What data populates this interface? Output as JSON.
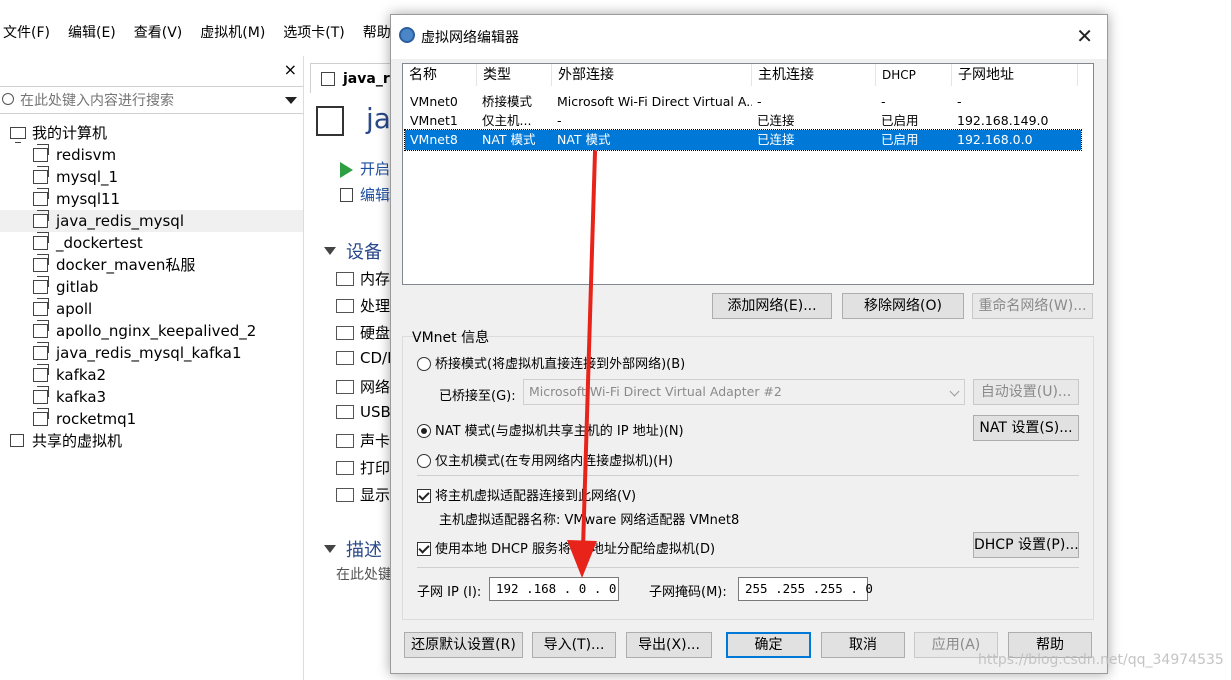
{
  "app": {
    "menu": [
      "文件(F)",
      "编辑(E)",
      "查看(V)",
      "虚拟机(M)",
      "选项卡(T)",
      "帮助"
    ],
    "library": {
      "close": "×",
      "search_placeholder": "在此处键入内容进行搜索",
      "root": "我的计算机",
      "vms": [
        "redisvm",
        "mysql_1",
        "mysql11",
        "java_redis_mysql",
        "_dockertest",
        "docker_maven私服",
        "gitlab",
        "apoll",
        "apollo_nginx_keepalived_2",
        "java_redis_mysql_kafka1",
        "kafka2",
        "kafka3",
        "rocketmq1"
      ],
      "shared": "共享的虚拟机"
    },
    "tab_label": "java_re",
    "vm_title": "jav",
    "actions": [
      "开启",
      "编辑"
    ],
    "devices_header": "设备",
    "devices": [
      "内存",
      "处理",
      "硬盘",
      "CD/D",
      "网络",
      "USB",
      "声卡",
      "打印",
      "显示"
    ],
    "describe_header": "描述",
    "describe_text": "在此处键"
  },
  "dialog": {
    "title": "虚拟网络编辑器",
    "close": "✕",
    "columns": [
      "名称",
      "类型",
      "外部连接",
      "主机连接",
      "DHCP",
      "子网地址"
    ],
    "rows": [
      [
        "VMnet0",
        "桥接模式",
        "Microsoft Wi-Fi Direct Virtual A...",
        "-",
        "-",
        "-"
      ],
      [
        "VMnet1",
        "仅主机...",
        "-",
        "已连接",
        "已启用",
        "192.168.149.0"
      ],
      [
        "VMnet8",
        "NAT 模式",
        "NAT 模式",
        "已连接",
        "已启用",
        "192.168.0.0"
      ]
    ],
    "selected_row": 2,
    "buttons": {
      "add": "添加网络(E)...",
      "remove": "移除网络(O)",
      "rename": "重命名网络(W)...",
      "auto": "自动设置(U)...",
      "nat": "NAT 设置(S)...",
      "dhcp": "DHCP 设置(P)...",
      "restore": "还原默认设置(R)",
      "import": "导入(T)...",
      "export": "导出(X)...",
      "ok": "确定",
      "cancel": "取消",
      "apply": "应用(A)",
      "help": "帮助"
    },
    "info_label": "VMnet 信息",
    "radio_bridge": "桥接模式(将虚拟机直接连接到外部网络)(B)",
    "bridged_to_label": "已桥接至(G):",
    "bridged_to_value": "Microsoft Wi-Fi Direct Virtual Adapter #2",
    "radio_nat": "NAT 模式(与虚拟机共享主机的 IP 地址)(N)",
    "radio_hostonly": "仅主机模式(在专用网络内连接虚拟机)(H)",
    "check_connect": "将主机虚拟适配器连接到此网络(V)",
    "adapter_name": "主机虚拟适配器名称: VMware 网络适配器 VMnet8",
    "check_dhcp": "使用本地 DHCP 服务将 IP 地址分配给虚拟机(D)",
    "subnet_ip_label": "子网 IP (I):",
    "subnet_ip": "192 .168 . 0  . 0",
    "subnet_mask_label": "子网掩码(M):",
    "subnet_mask": "255 .255 .255 . 0"
  },
  "watermark": "https://blog.csdn.net/qq_34974535",
  "colors": {
    "selection": "#0078d7",
    "arrow": "#e8231a",
    "title_blue": "#2b4a8b"
  }
}
